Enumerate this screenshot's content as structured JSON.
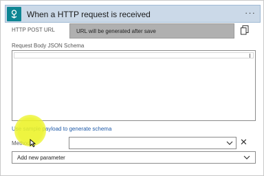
{
  "header": {
    "title": "When a HTTP request is received",
    "more": "···",
    "icon": "http-request-trigger-icon",
    "color": "#0d8593"
  },
  "http_post_url": {
    "label": "HTTP POST URL",
    "value": "URL will be generated after save",
    "copy_icon": "copy-icon"
  },
  "schema": {
    "label": "Request Body JSON Schema",
    "value": ""
  },
  "sample_link": "Use sample payload to generate schema",
  "method": {
    "label": "Method",
    "value": "",
    "clear": "✕"
  },
  "add_param": {
    "label": "Add new parameter"
  },
  "colors": {
    "header_bg": "#cbd9e8",
    "link": "#1f5aa8",
    "highlight": "#ecf326"
  }
}
